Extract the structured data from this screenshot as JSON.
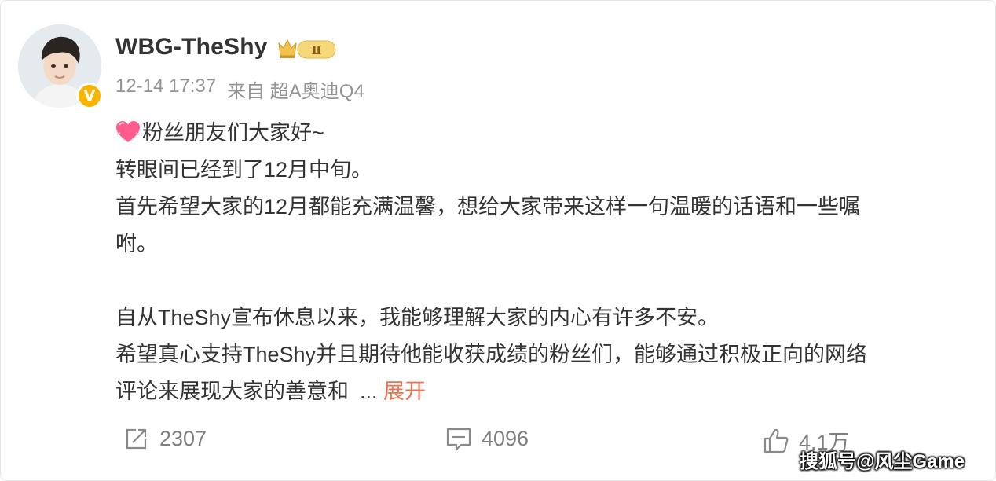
{
  "post": {
    "username": "WBG-TheShy",
    "time": "12-14 17:37",
    "source_prefix": "来自",
    "source": "超A奥迪Q4",
    "vip_level": "Ⅱ",
    "verified_mark": "V",
    "lines": {
      "line1": "粉丝朋友们大家好~",
      "line2": "转眼间已经到了12月中旬。",
      "line3": "首先希望大家的12月都能充满温馨，想给大家带来这样一句温暖的话语和一些嘱",
      "line4": "咐。",
      "line5": "自从TheShy宣布休息以来，我能够理解大家的内心有许多不安。",
      "line6": "希望真心支持TheShy并且期待他能收获成绩的粉丝们，能够通过积极正向的网络",
      "line7": "评论来展现大家的善意和"
    },
    "ellipsis": "...",
    "expand_label": "展开"
  },
  "actions": {
    "reposts": "2307",
    "comments": "4096",
    "likes": "4.1万"
  },
  "watermark": "搜狐号@风尘Game",
  "colors": {
    "text": "#333333",
    "meta": "#939393",
    "link": "#eb7350",
    "action": "#7f7f7f",
    "verified": "#f7b500"
  }
}
